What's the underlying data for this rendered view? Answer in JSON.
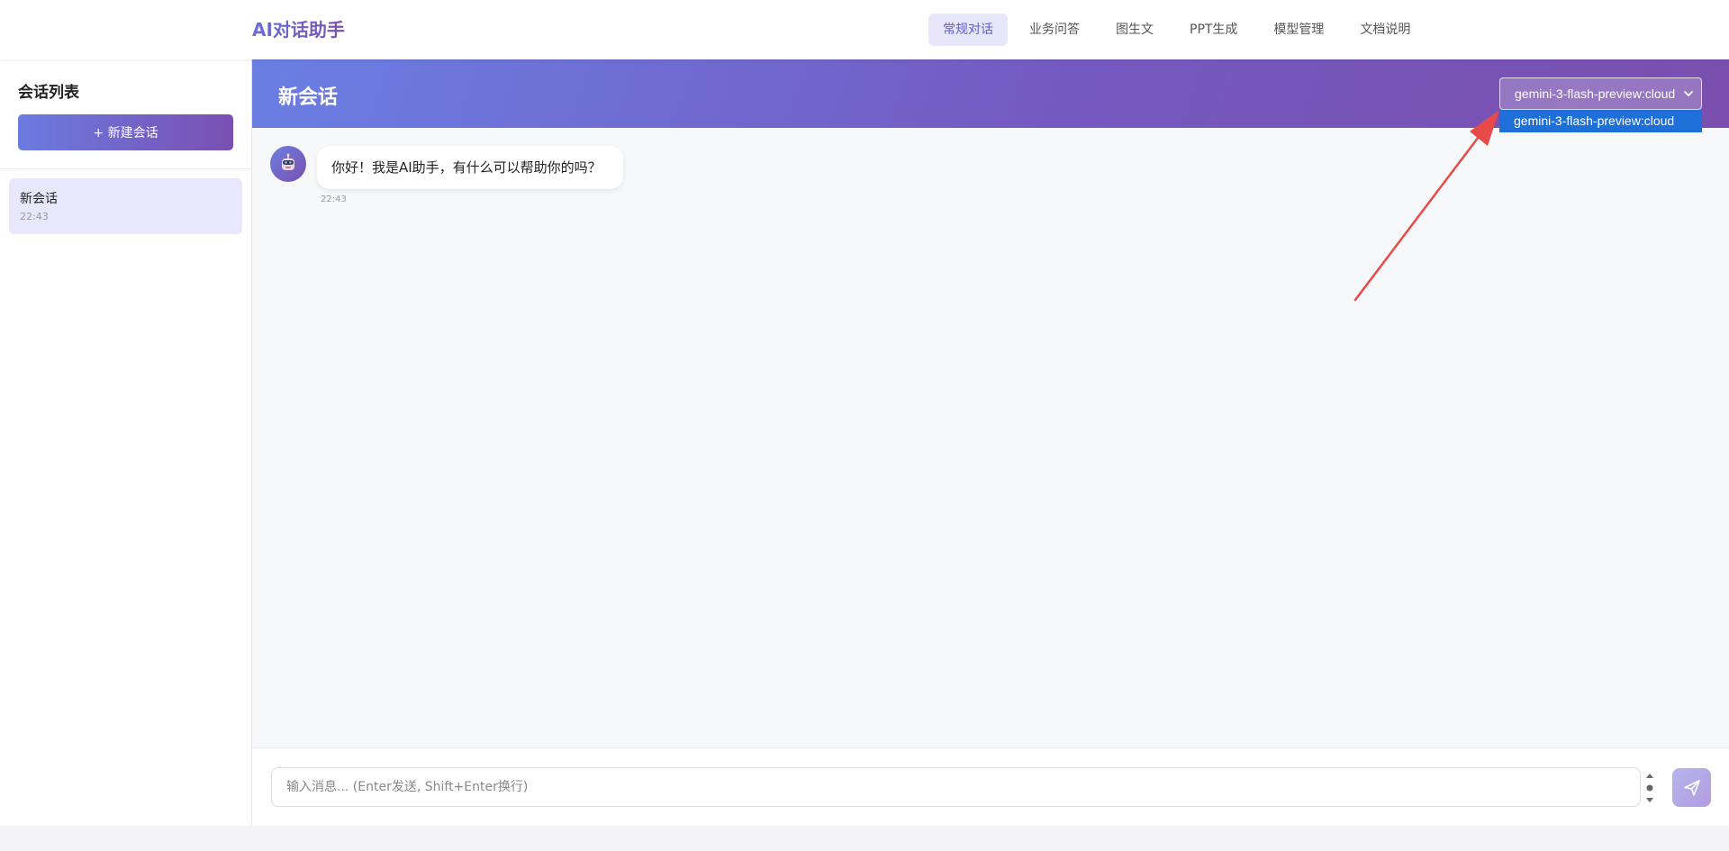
{
  "header": {
    "brand": "AI对话助手",
    "nav": [
      {
        "label": "常规对话",
        "active": true
      },
      {
        "label": "业务问答",
        "active": false
      },
      {
        "label": "图生文",
        "active": false
      },
      {
        "label": "PPT生成",
        "active": false
      },
      {
        "label": "模型管理",
        "active": false
      },
      {
        "label": "文档说明",
        "active": false
      }
    ]
  },
  "sidebar": {
    "title": "会话列表",
    "new_button": "+ 新建会话",
    "sessions": [
      {
        "name": "新会话",
        "time": "22:43"
      }
    ]
  },
  "chat": {
    "title": "新会话",
    "model_select": {
      "selected": "gemini-3-flash-preview:cloud",
      "options": [
        "gemini-3-flash-preview:cloud"
      ]
    },
    "messages": [
      {
        "role": "assistant",
        "text": "你好！我是AI助手，有什么可以帮助你的吗？",
        "time": "22:43"
      }
    ]
  },
  "input": {
    "placeholder": "输入消息... (Enter发送, Shift+Enter换行)",
    "value": ""
  },
  "colors": {
    "accent_start": "#6a7fe3",
    "accent_end": "#7a4fae",
    "nav_active_bg": "#e8e6fb",
    "annotation_arrow": "#e84a4a",
    "dropdown_highlight": "#1f6fd9"
  },
  "icons": {
    "send": "send-icon",
    "robot": "robot-icon",
    "chevron": "chevron-down-icon"
  }
}
